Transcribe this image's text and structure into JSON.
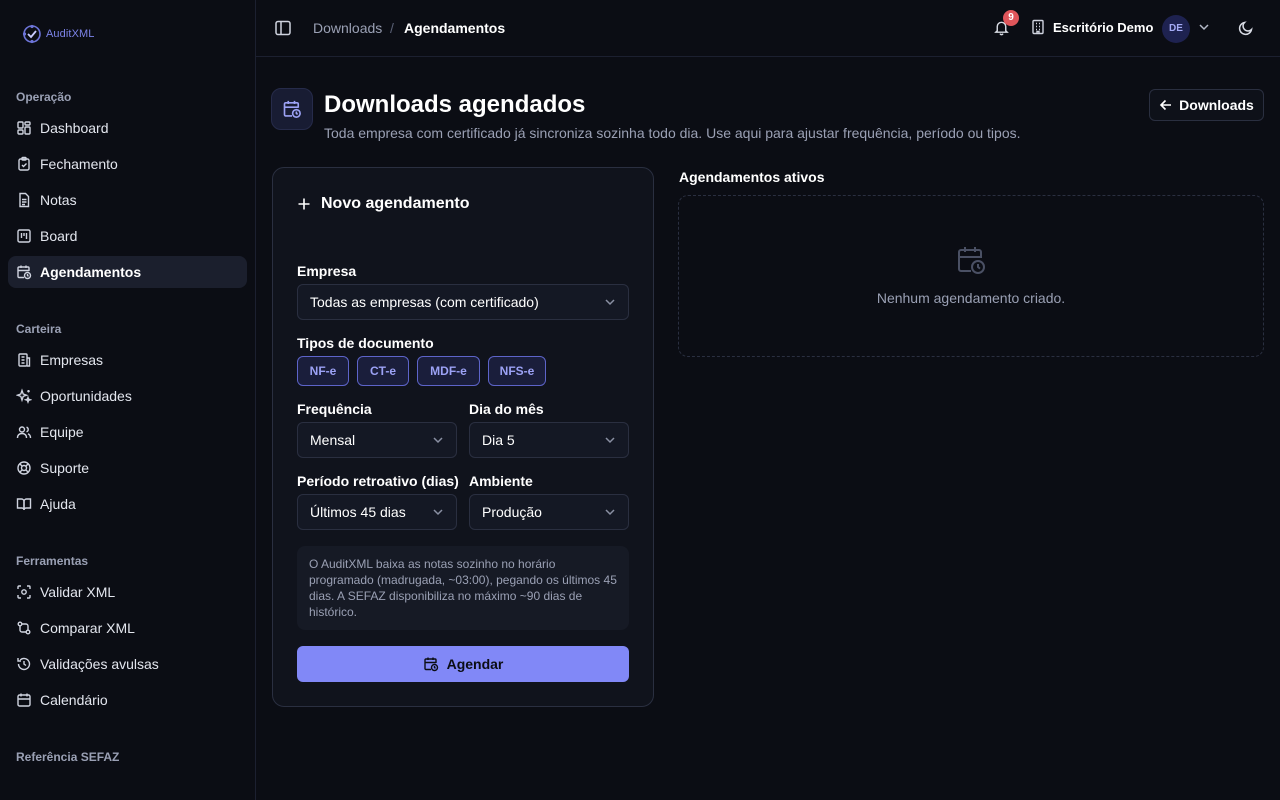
{
  "app": {
    "logo_text": "AuditXML"
  },
  "sidebar": {
    "groups": [
      {
        "title": "Operação",
        "items": [
          {
            "label": "Dashboard",
            "icon": "dashboard-icon"
          },
          {
            "label": "Fechamento",
            "icon": "clipboard-check-icon"
          },
          {
            "label": "Notas",
            "icon": "document-icon"
          },
          {
            "label": "Board",
            "icon": "kanban-icon"
          },
          {
            "label": "Agendamentos",
            "icon": "calendar-clock-icon",
            "active": true
          }
        ]
      },
      {
        "title": "Carteira",
        "items": [
          {
            "label": "Empresas",
            "icon": "building-icon"
          },
          {
            "label": "Oportunidades",
            "icon": "sparkles-icon"
          },
          {
            "label": "Equipe",
            "icon": "users-icon"
          },
          {
            "label": "Suporte",
            "icon": "life-buoy-icon"
          },
          {
            "label": "Ajuda",
            "icon": "book-icon"
          }
        ]
      },
      {
        "title": "Ferramentas",
        "items": [
          {
            "label": "Validar XML",
            "icon": "scan-icon"
          },
          {
            "label": "Comparar XML",
            "icon": "git-compare-icon"
          },
          {
            "label": "Validações avulsas",
            "icon": "history-icon"
          },
          {
            "label": "Calendário",
            "icon": "calendar-icon"
          }
        ]
      },
      {
        "title": "Referência SEFAZ",
        "items": []
      }
    ]
  },
  "topbar": {
    "breadcrumb": {
      "parent": "Downloads",
      "separator": "/",
      "current": "Agendamentos"
    },
    "notifications_count": "9",
    "org_name": "Escritório Demo",
    "avatar_initials": "DE"
  },
  "page": {
    "title": "Downloads agendados",
    "subtitle": "Toda empresa com certificado já sincroniza sozinha todo dia. Use aqui para ajustar frequência, período ou tipos.",
    "back_button_label": "Downloads"
  },
  "form": {
    "title": "Novo agendamento",
    "company_label": "Empresa",
    "company_value": "Todas as empresas (com certificado)",
    "doc_types_label": "Tipos de documento",
    "doc_types": [
      "NF-e",
      "CT-e",
      "MDF-e",
      "NFS-e"
    ],
    "frequency_label": "Frequência",
    "frequency_value": "Mensal",
    "day_label": "Dia do mês",
    "day_value": "Dia 5",
    "period_label": "Período retroativo (dias)",
    "period_value": "Últimos 45 dias",
    "env_label": "Ambiente",
    "env_value": "Produção",
    "info_text": "O AuditXML baixa as notas sozinho no horário programado (madrugada, ~03:00), pegando os últimos 45 dias. A SEFAZ disponibiliza no máximo ~90 dias de histórico.",
    "submit_label": "Agendar"
  },
  "active": {
    "title": "Agendamentos ativos",
    "empty_text": "Nenhum agendamento criado."
  },
  "colors": {
    "accent": "#8188f7",
    "background": "#0b0d14",
    "card": "#10131c",
    "badge": "#e0565b"
  }
}
